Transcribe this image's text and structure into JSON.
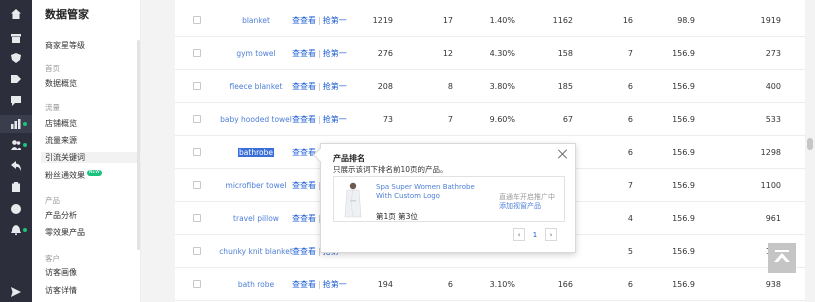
{
  "rail": {
    "icons": [
      "home-icon",
      "archive-icon",
      "shield-icon",
      "tag-icon",
      "chat-icon",
      "chart-icon",
      "people-icon",
      "share-icon",
      "clipboard-icon",
      "compass-icon",
      "bell-icon",
      "send-icon"
    ]
  },
  "sidebar": {
    "title": "数据管家",
    "items": [
      {
        "kind": "item",
        "label": "商家星等级"
      },
      {
        "kind": "group",
        "label": "首页"
      },
      {
        "kind": "item",
        "label": "数据概览"
      },
      {
        "kind": "group",
        "label": "流量"
      },
      {
        "kind": "item",
        "label": "店铺概览"
      },
      {
        "kind": "item",
        "label": "流量来源"
      },
      {
        "kind": "item",
        "label": "引流关键词",
        "selected": true
      },
      {
        "kind": "item",
        "label": "粉丝通效果",
        "badge": "NEW"
      },
      {
        "kind": "group",
        "label": "产品"
      },
      {
        "kind": "item",
        "label": "产品分析"
      },
      {
        "kind": "item",
        "label": "零效果产品"
      },
      {
        "kind": "group",
        "label": "客户"
      },
      {
        "kind": "item",
        "label": "访客画像"
      },
      {
        "kind": "item",
        "label": "访客详情"
      }
    ]
  },
  "table": {
    "action_view": "查查看",
    "action_grab": "抢第一",
    "rows": [
      {
        "keyword": "blanket",
        "c1": "1219",
        "c2": "17",
        "c3": "1.40%",
        "c4": "1162",
        "c5": "16",
        "c6": "98.9",
        "c7": "1919"
      },
      {
        "keyword": "gym towel",
        "c1": "276",
        "c2": "12",
        "c3": "4.30%",
        "c4": "158",
        "c5": "7",
        "c6": "156.9",
        "c7": "273"
      },
      {
        "keyword": "fleece blanket",
        "c1": "208",
        "c2": "8",
        "c3": "3.80%",
        "c4": "185",
        "c5": "6",
        "c6": "156.9",
        "c7": "400"
      },
      {
        "keyword": "baby hooded towel",
        "c1": "73",
        "c2": "7",
        "c3": "9.60%",
        "c4": "67",
        "c5": "6",
        "c6": "156.9",
        "c7": "533"
      },
      {
        "keyword": "bathrobe",
        "highlight": true,
        "c1": "",
        "c2": "",
        "c3": "",
        "c4": "",
        "c5": "6",
        "c6": "156.9",
        "c7": "1298"
      },
      {
        "keyword": "microfiber towel",
        "c1": "",
        "c2": "",
        "c3": "",
        "c4": "",
        "c5": "7",
        "c6": "156.9",
        "c7": "1100"
      },
      {
        "keyword": "travel pillow",
        "c1": "",
        "c2": "",
        "c3": "",
        "c4": "",
        "c5": "4",
        "c6": "156.9",
        "c7": "961"
      },
      {
        "keyword": "chunky knit blanket",
        "c1": "",
        "c2": "",
        "c3": "",
        "c4": "",
        "c5": "5",
        "c6": "156.9",
        "c7": "110"
      },
      {
        "keyword": "bath robe",
        "c1": "194",
        "c2": "6",
        "c3": "3.10%",
        "c4": "166",
        "c5": "6",
        "c6": "156.9",
        "c7": "938"
      }
    ]
  },
  "popup": {
    "title": "产品排名",
    "subtitle": "只展示该词下排名前10页的产品。",
    "product_name": "Spa Super Women Bathrobe With Custom Logo",
    "rank": "第1页 第3位",
    "note": "直通车开启推广中",
    "link": "添加视窗产品",
    "page": "1",
    "prev": "‹",
    "next": "›"
  }
}
